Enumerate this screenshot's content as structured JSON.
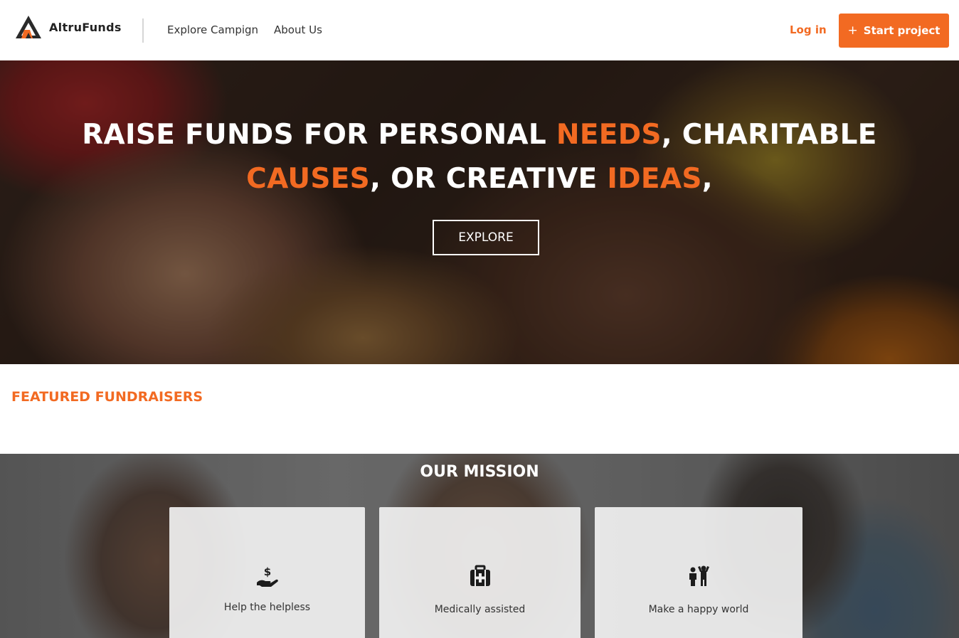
{
  "header": {
    "brand": "AltruFunds",
    "nav": {
      "explore": "Explore Campign",
      "about": "About Us"
    },
    "login": "Log in",
    "start_project": "Start project",
    "start_icon": "plus-icon"
  },
  "hero": {
    "line1_a": "RAISE FUNDS FOR PERSONAL ",
    "line1_hl": "NEEDS",
    "line1_b": ", CHARITABLE",
    "line2_hl1": "CAUSES",
    "line2_a": ", OR CREATIVE ",
    "line2_hl2": "IDEAS",
    "line2_b": ",",
    "explore_button": "EXPLORE"
  },
  "featured": {
    "title": "FEATURED FUNDRAISERS"
  },
  "mission": {
    "title": "OUR MISSION",
    "cards": [
      {
        "label": "Help the helpless",
        "icon": "donation-hand-icon"
      },
      {
        "label": "Medically assisted",
        "icon": "medical-kit-icon"
      },
      {
        "label": "Make a happy world",
        "icon": "people-cheering-icon"
      }
    ]
  },
  "colors": {
    "accent": "#f26a22",
    "text_dark": "#222222",
    "white": "#ffffff"
  }
}
